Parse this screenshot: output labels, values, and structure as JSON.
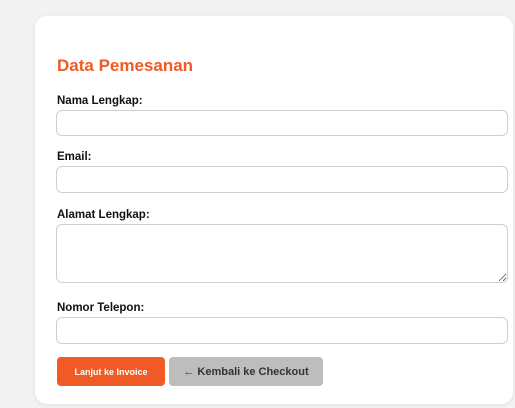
{
  "form": {
    "title": "Data Pemesanan",
    "fields": {
      "nama": {
        "label": "Nama Lengkap:",
        "value": ""
      },
      "email": {
        "label": "Email:",
        "value": ""
      },
      "alamat": {
        "label": "Alamat Lengkap:",
        "value": ""
      },
      "telepon": {
        "label": "Nomor Telepon:",
        "value": ""
      }
    },
    "buttons": {
      "submit": "Lanjut ke Invoice",
      "back": "← Kembali ke Checkout"
    }
  },
  "colors": {
    "accent": "#f05a24",
    "secondary_button": "#bdbdbd"
  }
}
